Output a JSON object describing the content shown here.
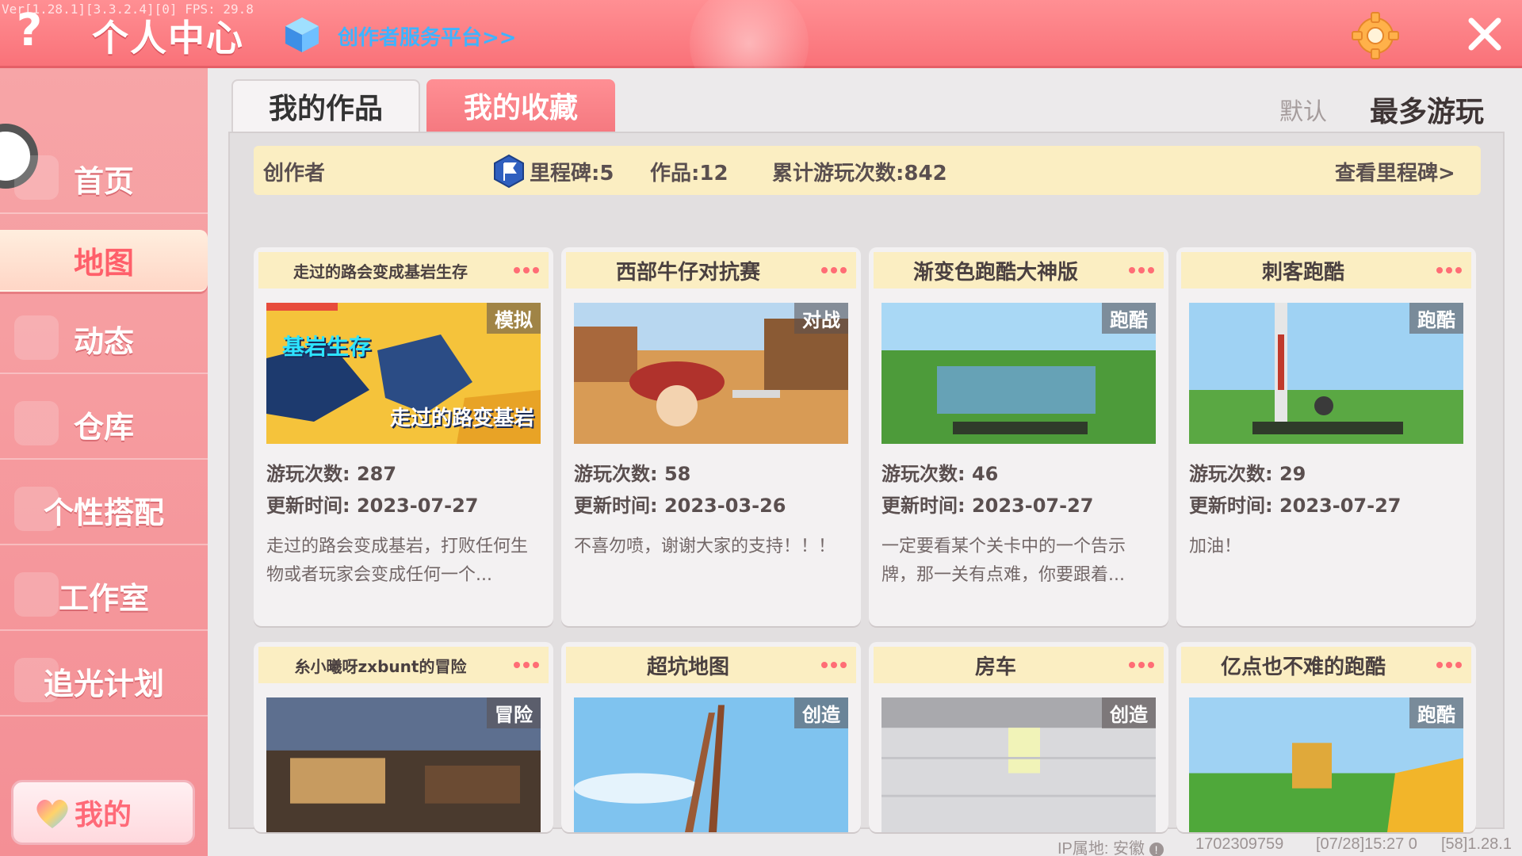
{
  "header": {
    "version": "Ver[1.28.1][3.3.2.4][0] FPS: 29.8",
    "help_glyph": "?",
    "title": "个人中心",
    "creator_link": "创作者服务平台>>",
    "close_glyph": "✕"
  },
  "sidebar": {
    "items": [
      {
        "label": "首页"
      },
      {
        "label": "地图"
      },
      {
        "label": "动态"
      },
      {
        "label": "仓库"
      },
      {
        "label": "个性搭配"
      },
      {
        "label": "工作室"
      },
      {
        "label": "追光计划"
      }
    ],
    "active_index": 1,
    "mine_label": "我的"
  },
  "tabs": {
    "works": "我的作品",
    "favorites": "我的收藏"
  },
  "sort": {
    "default": "默认",
    "most_played": "最多游玩"
  },
  "info_bar": {
    "creator": "创作者",
    "milestones": "里程碑:5",
    "works": "作品:12",
    "total_plays": "累计游玩次数:842",
    "view_milestones": "查看里程碑>"
  },
  "cards": [
    {
      "title": "走过的路会变成基岩生存",
      "tag": "模拟",
      "plays": "游玩次数: 287",
      "updated": "更新时间: 2023-07-27",
      "desc": "走过的路会变成基岩，打败任何生物或者玩家会变成任何一个...",
      "thumb_texts": [
        "基岩生存",
        "走过的路变基岩"
      ]
    },
    {
      "title": "西部牛仔对抗赛",
      "tag": "对战",
      "plays": "游玩次数: 58",
      "updated": "更新时间: 2023-03-26",
      "desc": "不喜勿喷，谢谢大家的支持！！！"
    },
    {
      "title": "渐变色跑酷大神版",
      "tag": "跑酷",
      "plays": "游玩次数: 46",
      "updated": "更新时间: 2023-07-27",
      "desc": "一定要看某个关卡中的一个告示牌，那一关有点难，你要跟着..."
    },
    {
      "title": "刺客跑酷",
      "tag": "跑酷",
      "plays": "游玩次数: 29",
      "updated": "更新时间: 2023-07-27",
      "desc": "加油！"
    },
    {
      "title": "糸小曦呀zxbunt的冒险",
      "tag": "冒险"
    },
    {
      "title": "超坑地图",
      "tag": "创造"
    },
    {
      "title": "房车",
      "tag": "创造"
    },
    {
      "title": "亿点也不难的跑酷",
      "tag": "跑酷"
    }
  ],
  "status": {
    "ip_location": "IP属地: 安徽",
    "uid": "1702309759",
    "timestamp": "[07/28]15:27 0",
    "build": "[58]1.28.1"
  },
  "colors": {
    "header": "#f97279",
    "sidebar": "#f48f95",
    "accent": "#ff6d75",
    "card_title": "#fbeec2",
    "link": "#3fb3ff"
  },
  "icons": [
    "help-icon",
    "cube-icon",
    "gear-icon",
    "close-icon",
    "milestone-flag-icon",
    "heart-icon",
    "more-dots-icon",
    "info-icon"
  ]
}
